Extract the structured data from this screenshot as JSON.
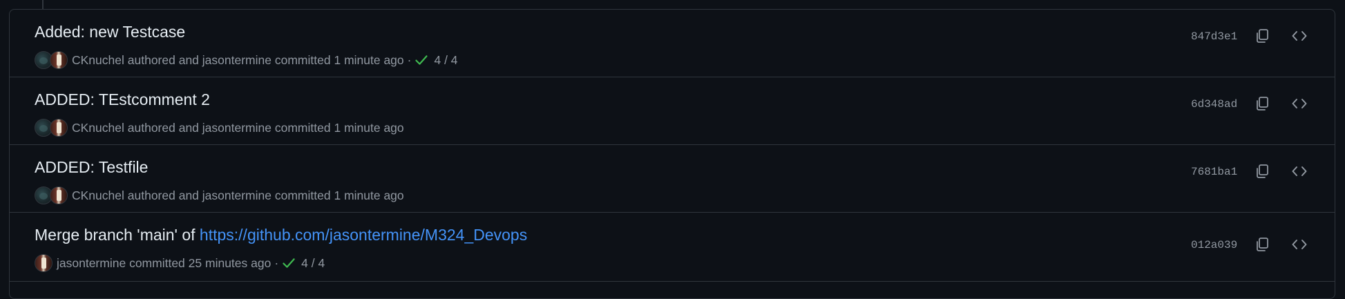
{
  "commits": [
    {
      "title": "Added: new Testcase",
      "title_link": "",
      "author": "CKnuchel",
      "authored_label": "authored and",
      "committer": "jasontermine",
      "committed_label": "committed",
      "time": "1 minute ago",
      "show_author_avatar": true,
      "checks": "4 / 4",
      "sha": "847d3e1"
    },
    {
      "title": "ADDED: TEstcomment 2",
      "title_link": "",
      "author": "CKnuchel",
      "authored_label": "authored and",
      "committer": "jasontermine",
      "committed_label": "committed",
      "time": "1 minute ago",
      "show_author_avatar": true,
      "checks": "",
      "sha": "6d348ad"
    },
    {
      "title": "ADDED: Testfile",
      "title_link": "",
      "author": "CKnuchel",
      "authored_label": "authored and",
      "committer": "jasontermine",
      "committed_label": "committed",
      "time": "1 minute ago",
      "show_author_avatar": true,
      "checks": "",
      "sha": "7681ba1"
    },
    {
      "title": "Merge branch 'main' of ",
      "title_link": "https://github.com/jasontermine/M324_Devops",
      "author": "",
      "authored_label": "",
      "committer": "jasontermine",
      "committed_label": "committed",
      "time": "25 minutes ago",
      "show_author_avatar": false,
      "checks": "4 / 4",
      "sha": "012a039"
    }
  ],
  "icons": {
    "copy": "copy-icon",
    "browse": "code-icon",
    "check": "check-icon"
  },
  "colors": {
    "background": "#0d1117",
    "border": "#30363d",
    "text_primary": "#e6edf3",
    "text_muted": "#9198a1",
    "link": "#4493f8",
    "success": "#3fb950"
  }
}
